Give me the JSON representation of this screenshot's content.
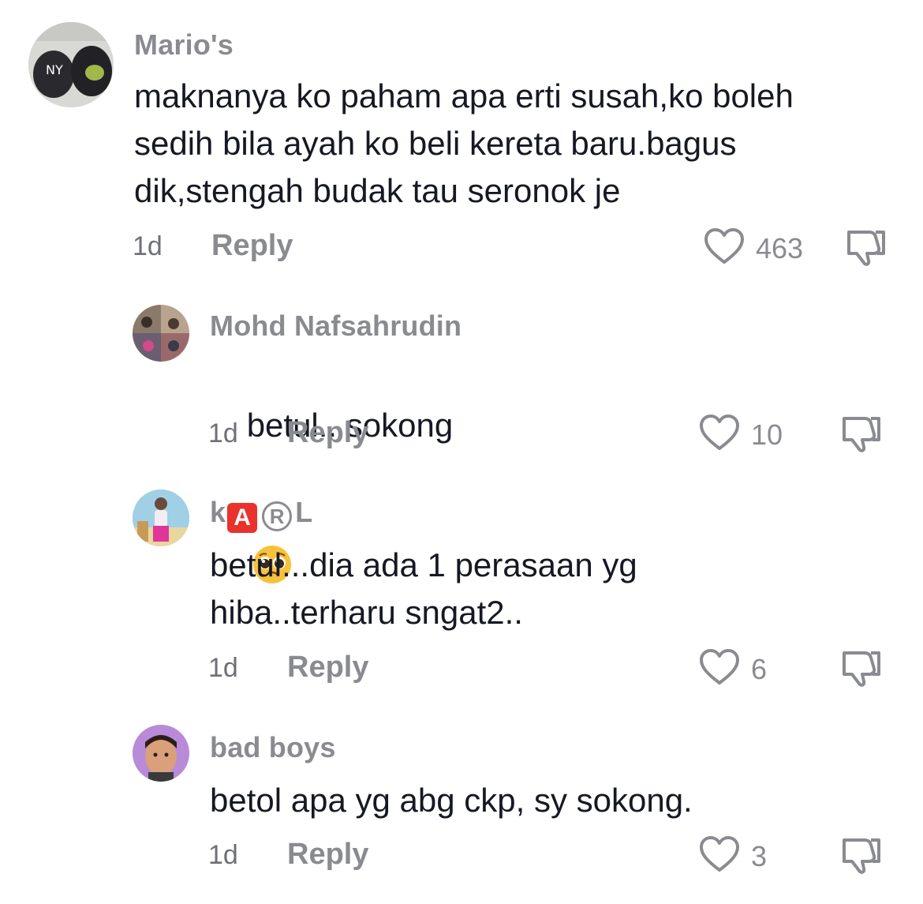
{
  "comments": [
    {
      "username": "Mario's",
      "text": "maknanya ko paham apa erti susah,ko boleh\nsedih bila ayah ko beli kereta baru.bagus\ndik,stengah budak tau seronok je",
      "time": "1d",
      "reply_label": "Reply",
      "likes": "463"
    },
    {
      "username": "Mohd Nafsahrudin",
      "text": "betul.. sokong",
      "emoji": "pleading-face",
      "time": "1d",
      "reply_label": "Reply",
      "likes": "10"
    },
    {
      "username_parts": [
        "k",
        "A",
        "R",
        "L"
      ],
      "text": "betul...dia ada 1 perasaan yg\nhiba..terharu sngat2..",
      "time": "1d",
      "reply_label": "Reply",
      "likes": "6"
    },
    {
      "username": "bad boys",
      "text": "betol apa yg abg ckp, sy sokong.",
      "time": "1d",
      "reply_label": "Reply",
      "likes": "3"
    }
  ],
  "icons": {
    "like": "heart-outline-icon",
    "dislike": "thumbs-down-icon"
  },
  "colors": {
    "text": "#161823",
    "muted": "#8a8b91",
    "badge_red": "#e8322b"
  }
}
